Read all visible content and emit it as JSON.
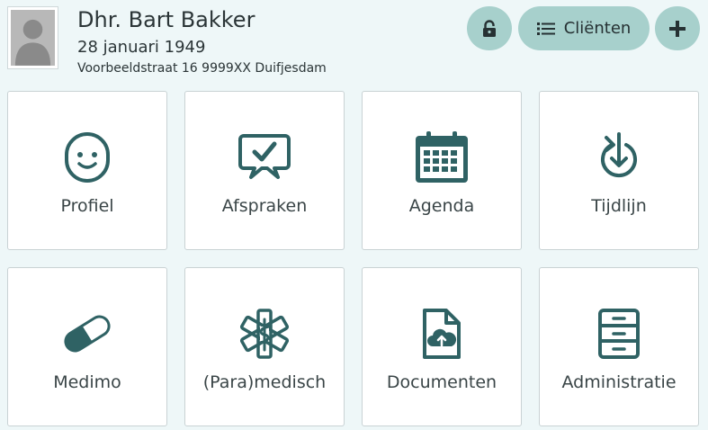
{
  "client": {
    "name": "Dhr. Bart Bakker",
    "dob": "28 januari 1949",
    "address": "Voorbeeldstraat 16 9999XX Duifjesdam"
  },
  "header_buttons": {
    "lock_icon": "lock-icon",
    "clients_label": "Cliënten",
    "clients_icon": "list-icon",
    "add_icon": "plus-icon"
  },
  "tiles": [
    {
      "label": "Profiel",
      "icon": "smiley-face-icon"
    },
    {
      "label": "Afspraken",
      "icon": "speech-bubble-check-icon"
    },
    {
      "label": "Agenda",
      "icon": "calendar-icon"
    },
    {
      "label": "Tijdlijn",
      "icon": "timeline-icon"
    },
    {
      "label": "Medimo",
      "icon": "pill-icon"
    },
    {
      "label": "(Para)medisch",
      "icon": "medical-star-icon"
    },
    {
      "label": "Documenten",
      "icon": "document-cloud-icon"
    },
    {
      "label": "Administratie",
      "icon": "file-cabinet-icon"
    }
  ],
  "colors": {
    "background": "#eef7f8",
    "button": "#a7d0cc",
    "icon": "#2f6264",
    "tile": "#ffffff"
  }
}
